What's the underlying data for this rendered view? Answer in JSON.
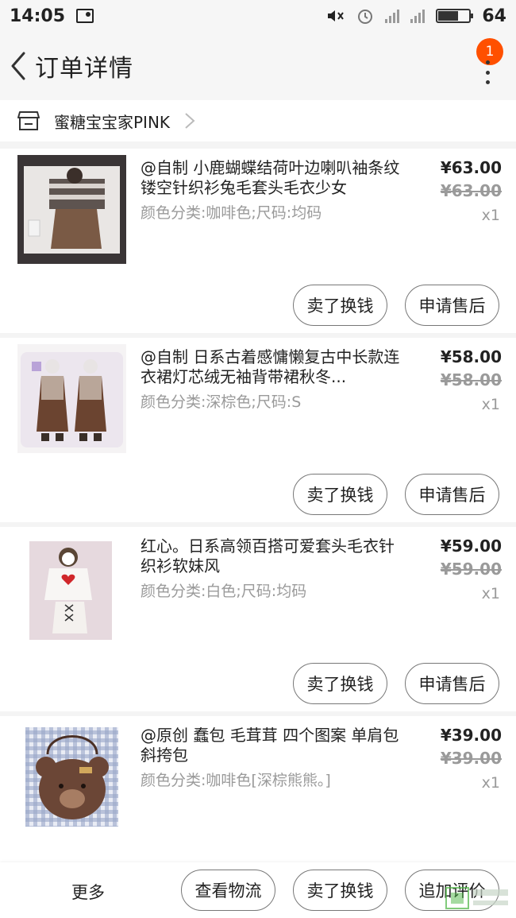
{
  "status": {
    "time": "14:05",
    "battery": "64",
    "battery_level": 0.64,
    "network": "4G"
  },
  "header": {
    "title": "订单详情",
    "notification_count": "1"
  },
  "shop": {
    "name": "蜜糖宝宝家PINK"
  },
  "items": [
    {
      "title": "@自制 小鹿蝴蝶结荷叶边喇叭袖条纹镂空针织衫兔毛套头毛衣少女",
      "sku": "颜色分类:咖啡色;尺码:均码",
      "price": "¥63.00",
      "original_price": "¥63.00",
      "quantity": "x1",
      "sell_label": "卖了换钱",
      "aftersale_label": "申请售后"
    },
    {
      "title": "@自制 日系古着感慵懒复古中长款连衣裙灯芯绒无袖背带裙秋冬...",
      "sku": "颜色分类:深棕色;尺码:S",
      "price": "¥58.00",
      "original_price": "¥58.00",
      "quantity": "x1",
      "sell_label": "卖了换钱",
      "aftersale_label": "申请售后"
    },
    {
      "title": "红心。日系高领百搭可爱套头毛衣针织衫软妹风",
      "sku": "颜色分类:白色;尺码:均码",
      "price": "¥59.00",
      "original_price": "¥59.00",
      "quantity": "x1",
      "sell_label": "卖了换钱",
      "aftersale_label": "申请售后"
    },
    {
      "title": "@原创 蠢包 毛茸茸 四个图案 单肩包 斜挎包",
      "sku": "颜色分类:咖啡色[深棕熊熊。]",
      "price": "¥39.00",
      "original_price": "¥39.00",
      "quantity": "x1"
    }
  ],
  "bottom_bar": {
    "more_label": "更多",
    "logistics_label": "查看物流",
    "sell_label": "卖了换钱",
    "review_label": "追加评价"
  },
  "colors": {
    "accent": "#ff5000",
    "text": "#222222",
    "muted": "#9a9a9a"
  }
}
